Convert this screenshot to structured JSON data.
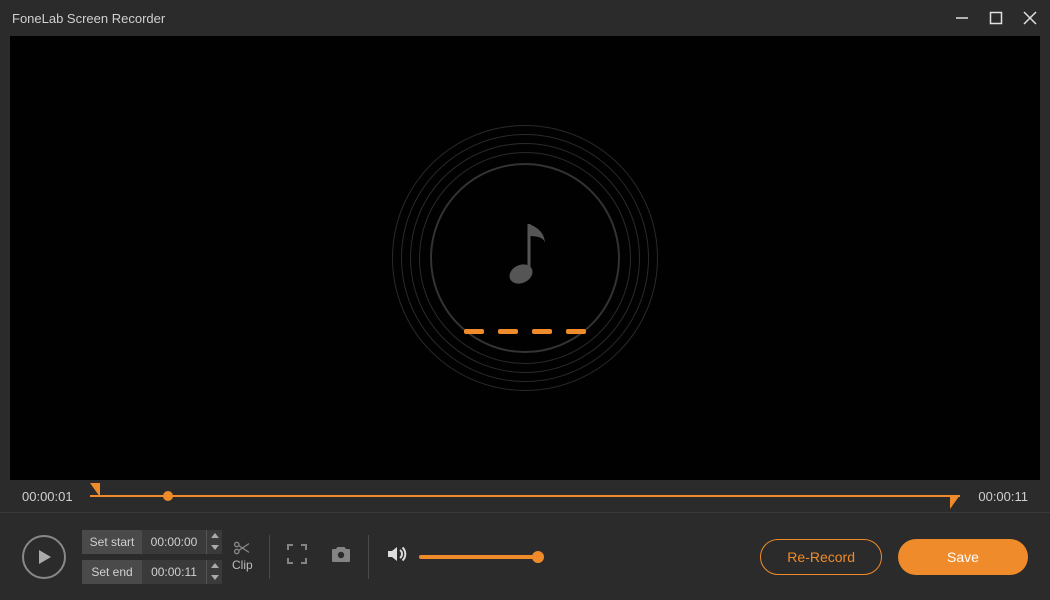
{
  "app": {
    "title": "FoneLab Screen Recorder"
  },
  "timeline": {
    "current_time": "00:00:01",
    "total_time": "00:00:11",
    "playhead_percent": 9,
    "range_start_percent": 0,
    "range_end_percent": 100
  },
  "clip": {
    "set_start_label": "Set start",
    "set_end_label": "Set end",
    "start_value": "00:00:00",
    "end_value": "00:00:11",
    "clip_label": "Clip"
  },
  "buttons": {
    "re_record": "Re-Record",
    "save": "Save"
  },
  "colors": {
    "accent": "#ef8b2a"
  },
  "volume": {
    "level_percent": 95
  },
  "icons": {
    "minimize": "minimize-icon",
    "maximize": "maximize-icon",
    "close": "close-icon",
    "play": "play-icon",
    "fullscreen": "fullscreen-icon",
    "camera": "camera-icon",
    "speaker": "speaker-icon",
    "scissor": "scissor-icon",
    "music_note": "music-note-icon"
  }
}
